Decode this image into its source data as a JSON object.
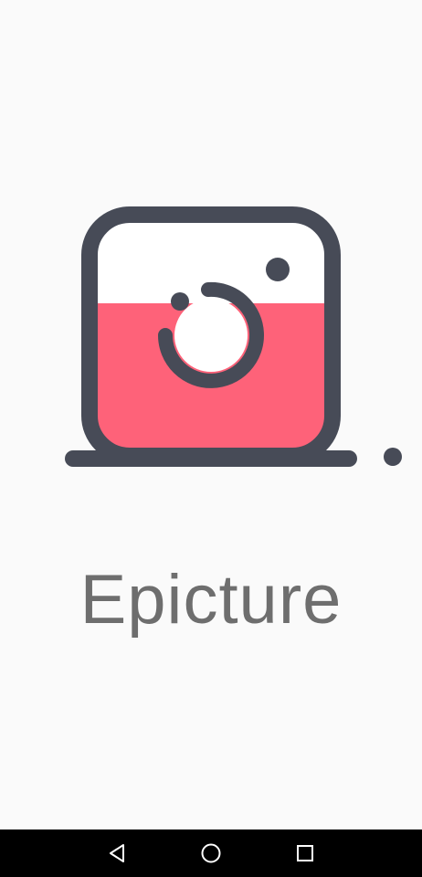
{
  "app": {
    "name": "Epicture"
  },
  "icons": {
    "logo": "camera-logo-icon",
    "back": "back-triangle-icon",
    "home": "home-circle-icon",
    "recent": "recent-square-icon"
  },
  "colors": {
    "background": "#fafafa",
    "logo_outline": "#474b57",
    "logo_fill": "#fe6279",
    "logo_top": "#ffffff",
    "title_text": "#6e6e6e",
    "nav_bar": "#000000"
  }
}
